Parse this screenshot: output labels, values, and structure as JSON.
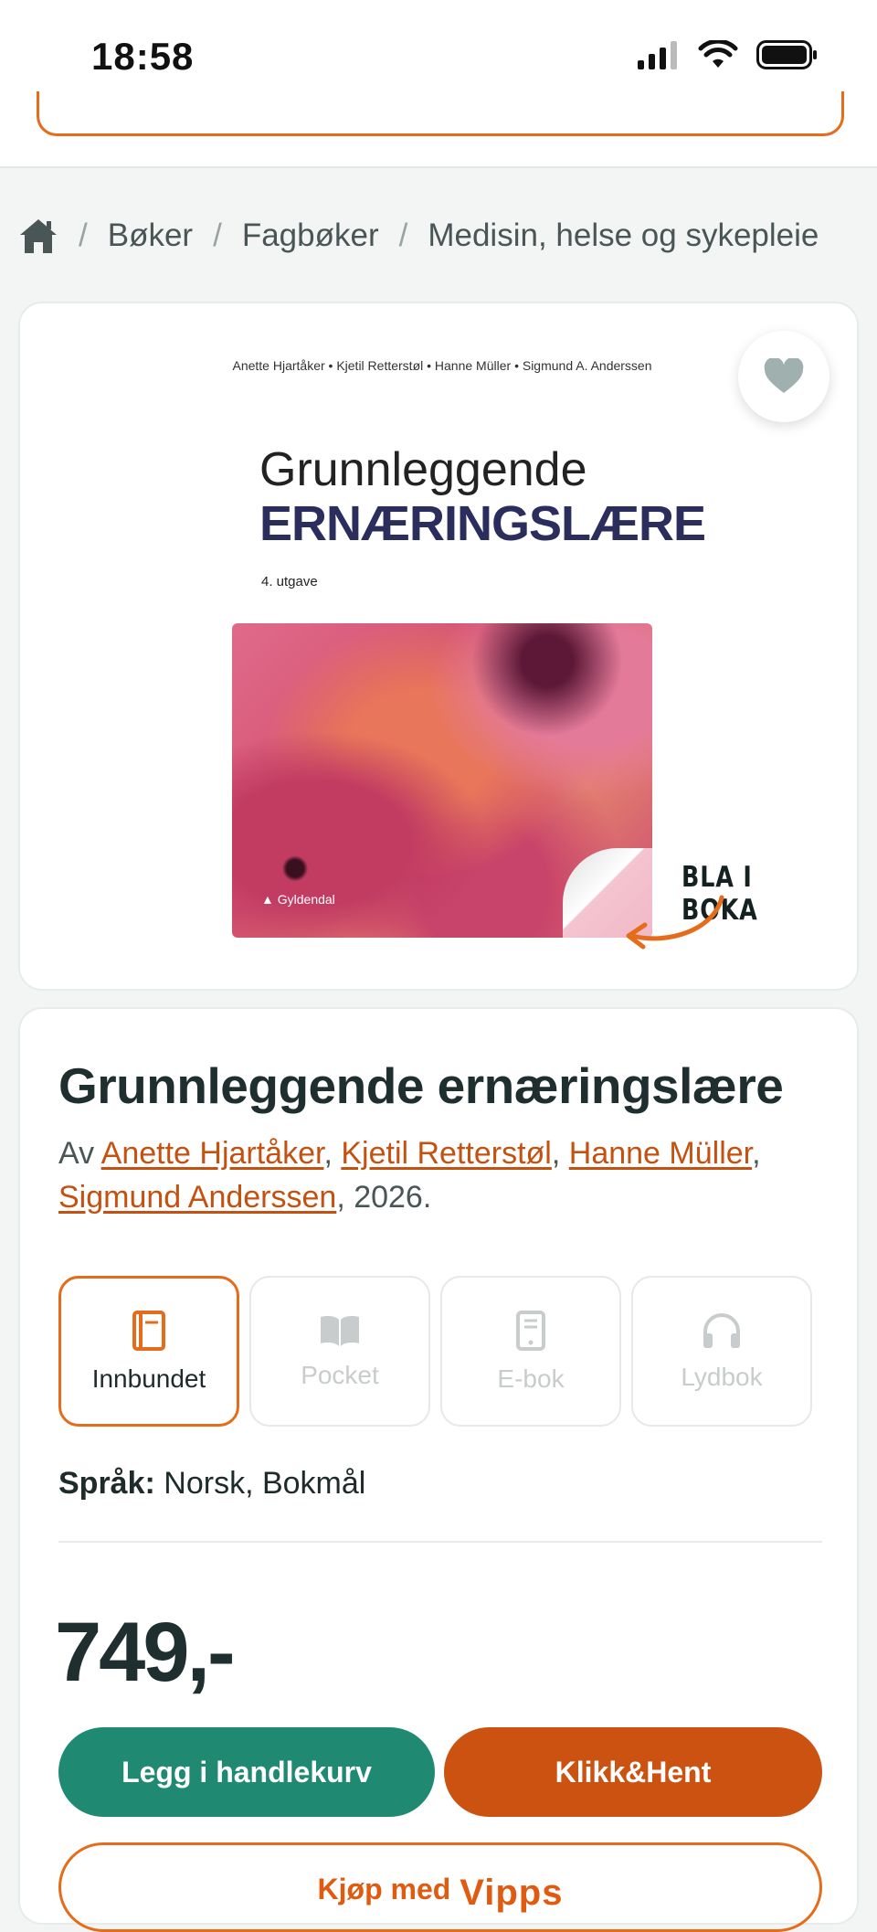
{
  "status_bar": {
    "time": "18:58"
  },
  "breadcrumb": {
    "items": [
      "Bøker",
      "Fagbøker",
      "Medisin, helse og sykepleie"
    ],
    "separator": "/"
  },
  "cover": {
    "authors": "Anette Hjartåker • Kjetil Retterstøl • Hanne Müller • Sigmund A. Anderssen",
    "title_line1": "Grunnleggende",
    "title_line2": "ERNÆRINGSLÆRE",
    "edition": "4. utgave",
    "publisher": "Gyldendal",
    "peek_label": "BLA I BOKA"
  },
  "product": {
    "title": "Grunnleggende ernæringslære",
    "by_prefix": "Av",
    "authors": [
      "Anette Hjartåker",
      "Kjetil Retterstøl",
      "Hanne Müller",
      "Sigmund Anderssen"
    ],
    "year_suffix": ", 2026.",
    "formats": [
      {
        "label": "Innbundet",
        "icon": "hardcover-book-icon",
        "selected": true
      },
      {
        "label": "Pocket",
        "icon": "open-book-icon",
        "selected": false
      },
      {
        "label": "E-bok",
        "icon": "tablet-icon",
        "selected": false
      },
      {
        "label": "Lydbok",
        "icon": "headphones-icon",
        "selected": false
      }
    ],
    "language_label": "Språk:",
    "language_value": "Norsk, Bokmål",
    "price": "749,-"
  },
  "actions": {
    "add_to_cart": "Legg i handlekurv",
    "click_and_collect": "Klikk&Hent",
    "vipps_prefix": "Kjøp med",
    "vipps_brand": "Vipps"
  },
  "colors": {
    "accent_orange": "#e46c1a",
    "link_orange": "#c4510f",
    "primary_green": "#1f8a71",
    "click_orange": "#cc5211",
    "cover_title_navy": "#2b2d5c"
  }
}
